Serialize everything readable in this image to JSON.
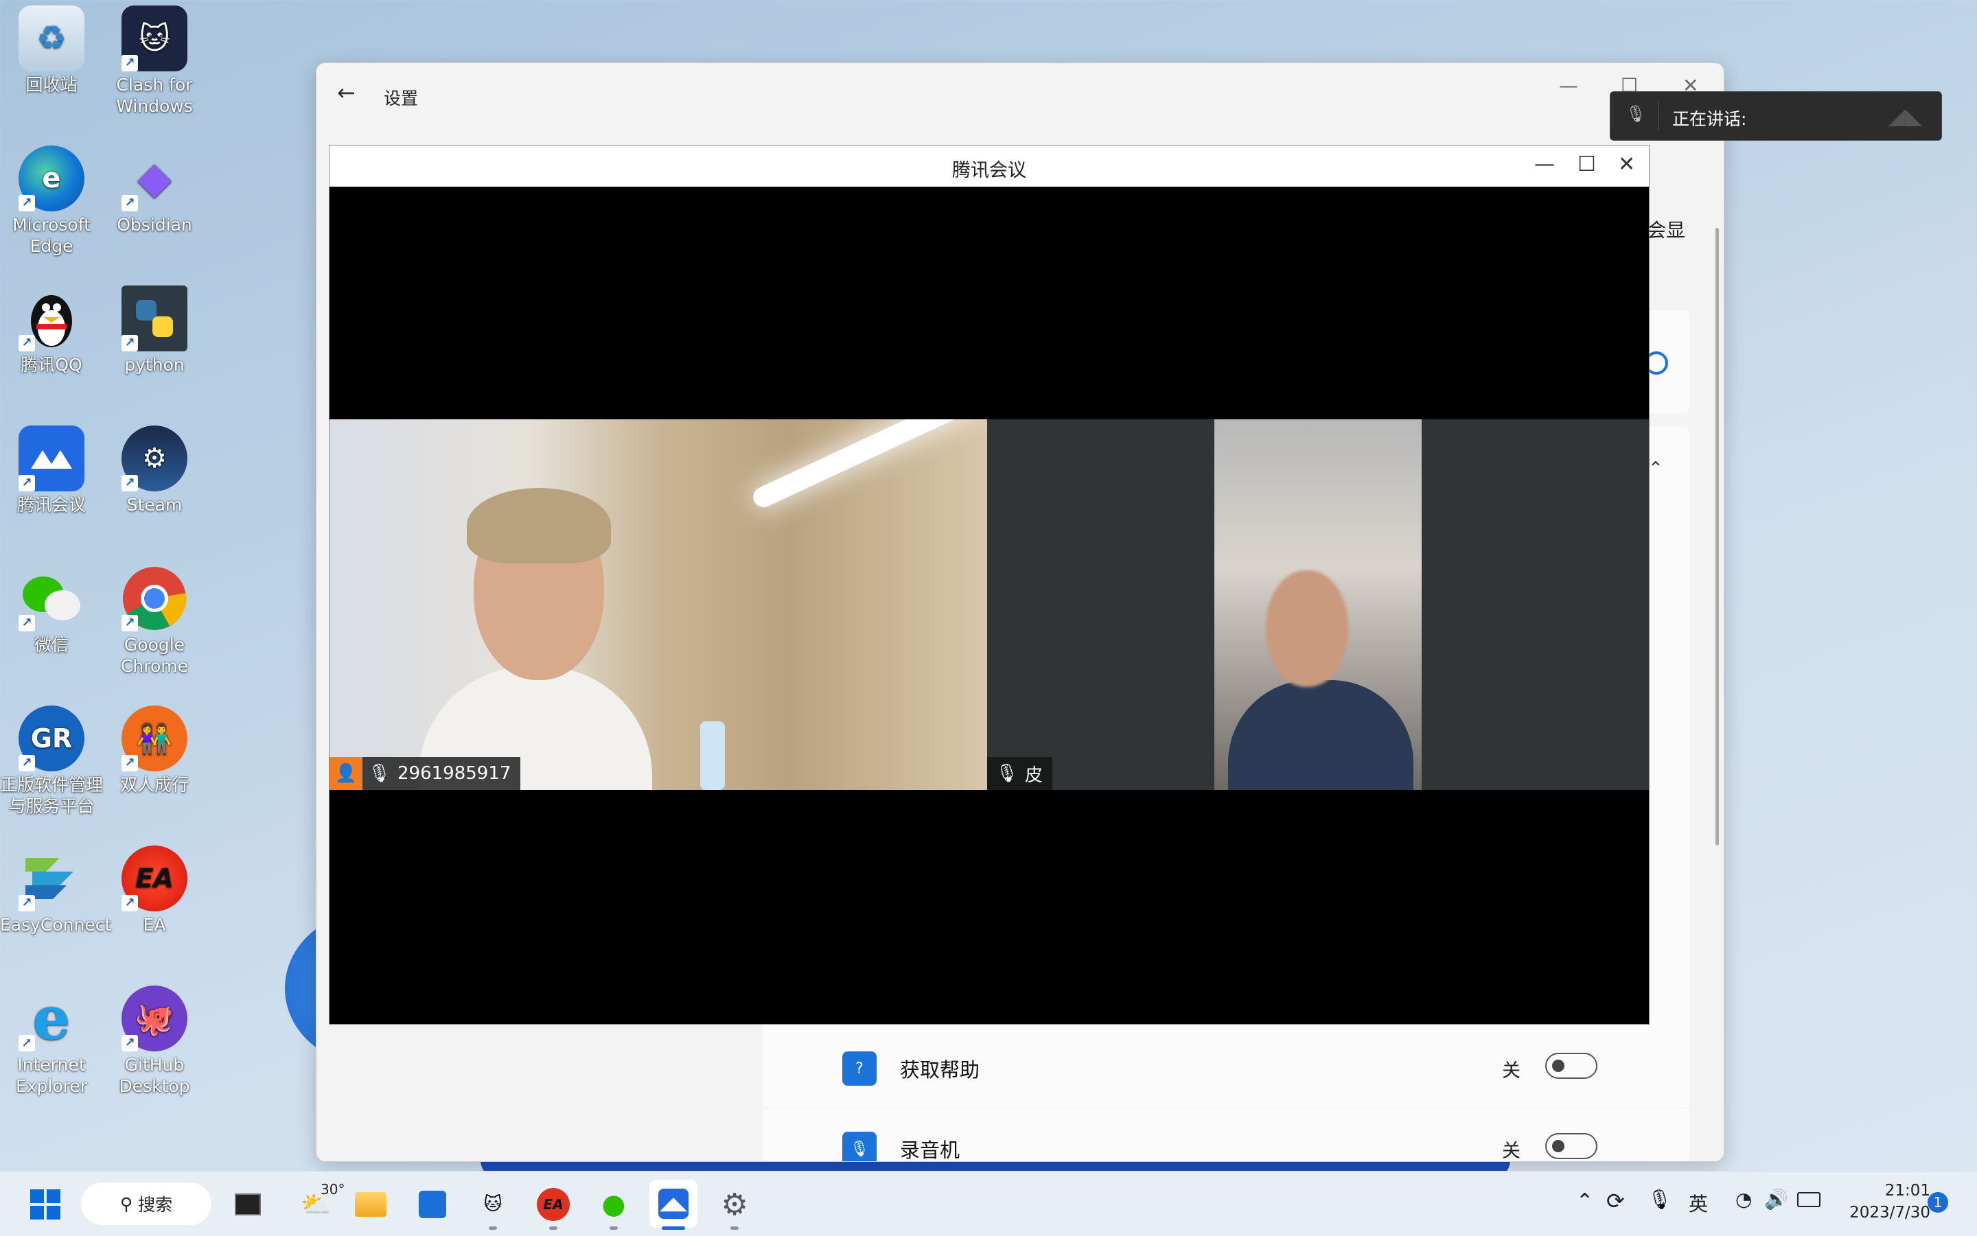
{
  "desktop": {
    "icons": [
      {
        "label": "回收站",
        "icon": "recycle-bin-icon"
      },
      {
        "label": "Clash for Windows",
        "icon": "clash-cat-icon"
      },
      {
        "label": "Microsoft Edge",
        "icon": "edge-icon"
      },
      {
        "label": "Obsidian",
        "icon": "obsidian-icon"
      },
      {
        "label": "腾讯QQ",
        "icon": "qq-penguin-icon"
      },
      {
        "label": "python",
        "icon": "python-icon"
      },
      {
        "label": "腾讯会议",
        "icon": "tencent-meeting-icon"
      },
      {
        "label": "Steam",
        "icon": "steam-icon"
      },
      {
        "label": "微信",
        "icon": "wechat-icon"
      },
      {
        "label": "Google Chrome",
        "icon": "chrome-icon"
      },
      {
        "label": "正版软件管理与服务平台",
        "icon": "software-platform-icon"
      },
      {
        "label": "双人成行",
        "icon": "it-takes-two-icon"
      },
      {
        "label": "EasyConnect",
        "icon": "easyconnect-icon"
      },
      {
        "label": "EA",
        "icon": "ea-icon"
      },
      {
        "label": "Internet Explorer",
        "icon": "ie-icon"
      },
      {
        "label": "GitHub Desktop",
        "icon": "github-icon"
      }
    ]
  },
  "settings": {
    "title": "设置",
    "partial_text": "会显",
    "rows": [
      {
        "name": "获取帮助",
        "state": "关"
      },
      {
        "name": "录音机",
        "state": "关"
      }
    ]
  },
  "meeting": {
    "title": "腾讯会议",
    "participants": [
      {
        "name": "2961985917"
      },
      {
        "name": "皮"
      }
    ]
  },
  "toast": {
    "text": "正在讲话:"
  },
  "taskbar": {
    "search_label": "搜索",
    "weather_temp": "30°",
    "ime": "英",
    "time": "21:01",
    "date": "2023/7/30",
    "notification_count": "1"
  }
}
